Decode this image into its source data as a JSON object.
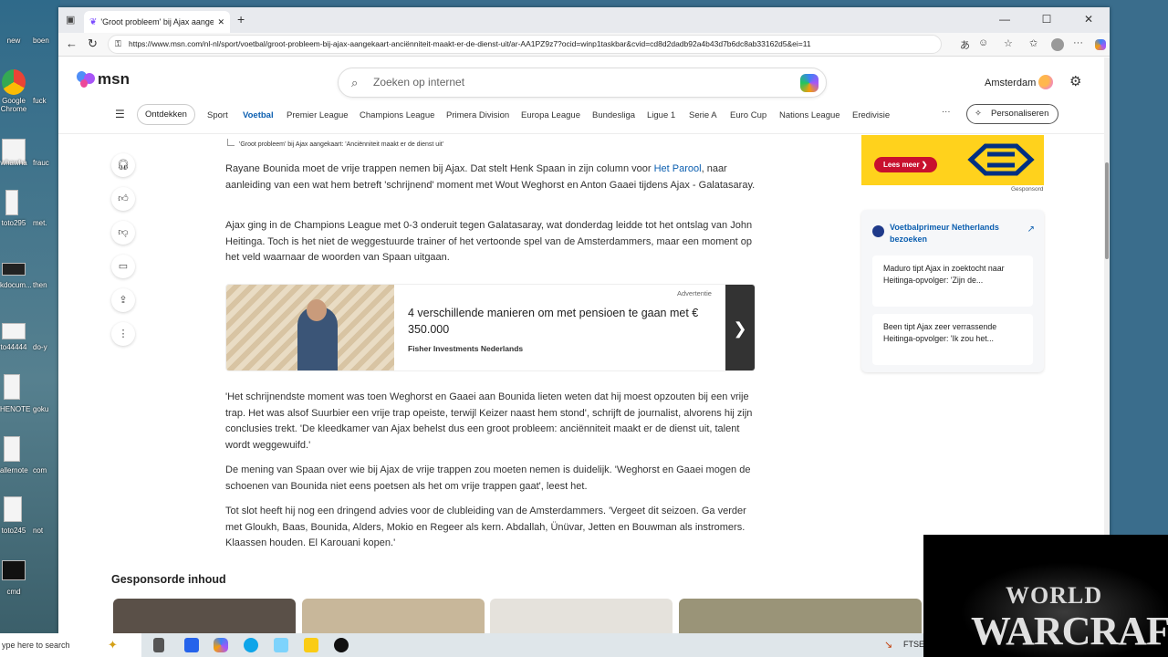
{
  "desktop": {
    "icons": [
      {
        "label": "new",
        "label2": "boen"
      },
      {
        "label": "Google Chrome",
        "label2": "fuck"
      },
      {
        "label": "whawha",
        "label2": "frauc"
      },
      {
        "label": "toto295",
        "label2": "met."
      },
      {
        "label": "kdocum...",
        "label2": "then"
      },
      {
        "label": "to44444",
        "label2": "do-y"
      },
      {
        "label": "HENOTE",
        "label2": "goku"
      },
      {
        "label": "allernote",
        "label2": "com"
      },
      {
        "label": "toto245",
        "label2": "not"
      },
      {
        "label": "cmd",
        "label2": ""
      }
    ]
  },
  "browser": {
    "tab_title": "'Groot probleem' bij Ajax aangek",
    "url": "https://www.msn.com/nl-nl/sport/voetbal/groot-probleem-bij-ajax-aangekaart-anciënniteit-maakt-er-de-dienst-uit/ar-AA1PZ9z7?ocid=winp1taskbar&cvid=cd8d2dadb92a4b43d7b6dc8ab33162d5&ei=11"
  },
  "header": {
    "logo": "msn",
    "search_placeholder": "Zoeken op internet",
    "location": "Amsterdam",
    "discover": "Ontdekken",
    "nav": [
      "Sport",
      "Voetbal",
      "Premier League",
      "Champions League",
      "Primera Division",
      "Europa League",
      "Bundesliga",
      "Ligue 1",
      "Serie A",
      "Euro Cup",
      "Nations League",
      "Eredivisie"
    ],
    "more": "···",
    "personalize": "Personaliseren"
  },
  "article": {
    "caption": "'Groot probleem' bij Ajax aangekaart: 'Anciënniteit maakt er de dienst uit'",
    "p1_a": "Rayane Bounida moet de vrije trappen nemen bij Ajax. Dat stelt Henk Spaan in zijn column voor ",
    "p1_link": "Het Parool",
    "p1_b": ", naar aanleiding van een wat hem betreft 'schrijnend' moment met Wout Weghorst en Anton Gaaei tijdens Ajax - Galatasaray.",
    "p2": "Ajax ging in de Champions League met 0-3 onderuit tegen Galatasaray, wat donderdag leidde tot het ontslag van John Heitinga. Toch is het niet de weggestuurde trainer of het vertoonde spel van de Amsterdammers, maar een moment op het veld waarnaar de woorden van Spaan uitgaan.",
    "p3": "'Het schrijnendste moment was toen Weghorst en Gaaei aan Bounida lieten weten dat hij moest opzouten bij een vrije trap. Het was alsof Suurbier een vrije trap opeiste, terwijl Keizer naast hem stond', schrijft de journalist, alvorens hij zijn conclusies trekt. 'De kleedkamer van Ajax behelst dus een groot probleem: anciënniteit maakt er de dienst uit, talent wordt weggewuifd.'",
    "p4": "De mening van Spaan over wie bij Ajax de vrije trappen zou moeten nemen is duidelijk. 'Weghorst en Gaaei mogen de schoenen van Bounida niet eens poetsen als het om vrije trappen gaat', leest het.",
    "p5": "Tot slot heeft hij nog een dringend advies voor de clubleiding van de Amsterdammers. 'Vergeet dit seizoen. Ga verder met Gloukh, Baas, Bounida, Alders, Mokio en Regeer als kern. Abdallah, Ünüvar, Jetten en Bouwman als instromers. Klaassen houden. El Karouani kopen.'"
  },
  "ad": {
    "label": "Advertentie",
    "title": "4 verschillende manieren om met pensioen te gaan met € 350.000",
    "source": "Fisher Investments Nederlands"
  },
  "sponsored_heading": "Gesponsorde inhoud",
  "sidebar": {
    "ad_button": "Lees meer ❯",
    "ad_tag": "Gesponsord",
    "source": "Voetbalprimeur Netherlands bezoeken",
    "stories": [
      "Maduro tipt Ajax in zoektocht naar Heitinga-opvolger: 'Zijn de...",
      "Been tipt Ajax zeer verrassende Heitinga-opvolger: 'Ik zou het..."
    ]
  },
  "taskbar": {
    "search": "ype here to search",
    "ftse": "FTSE"
  },
  "overlay": {
    "line1": "WORLD",
    "line2": "WARCRAFT"
  }
}
